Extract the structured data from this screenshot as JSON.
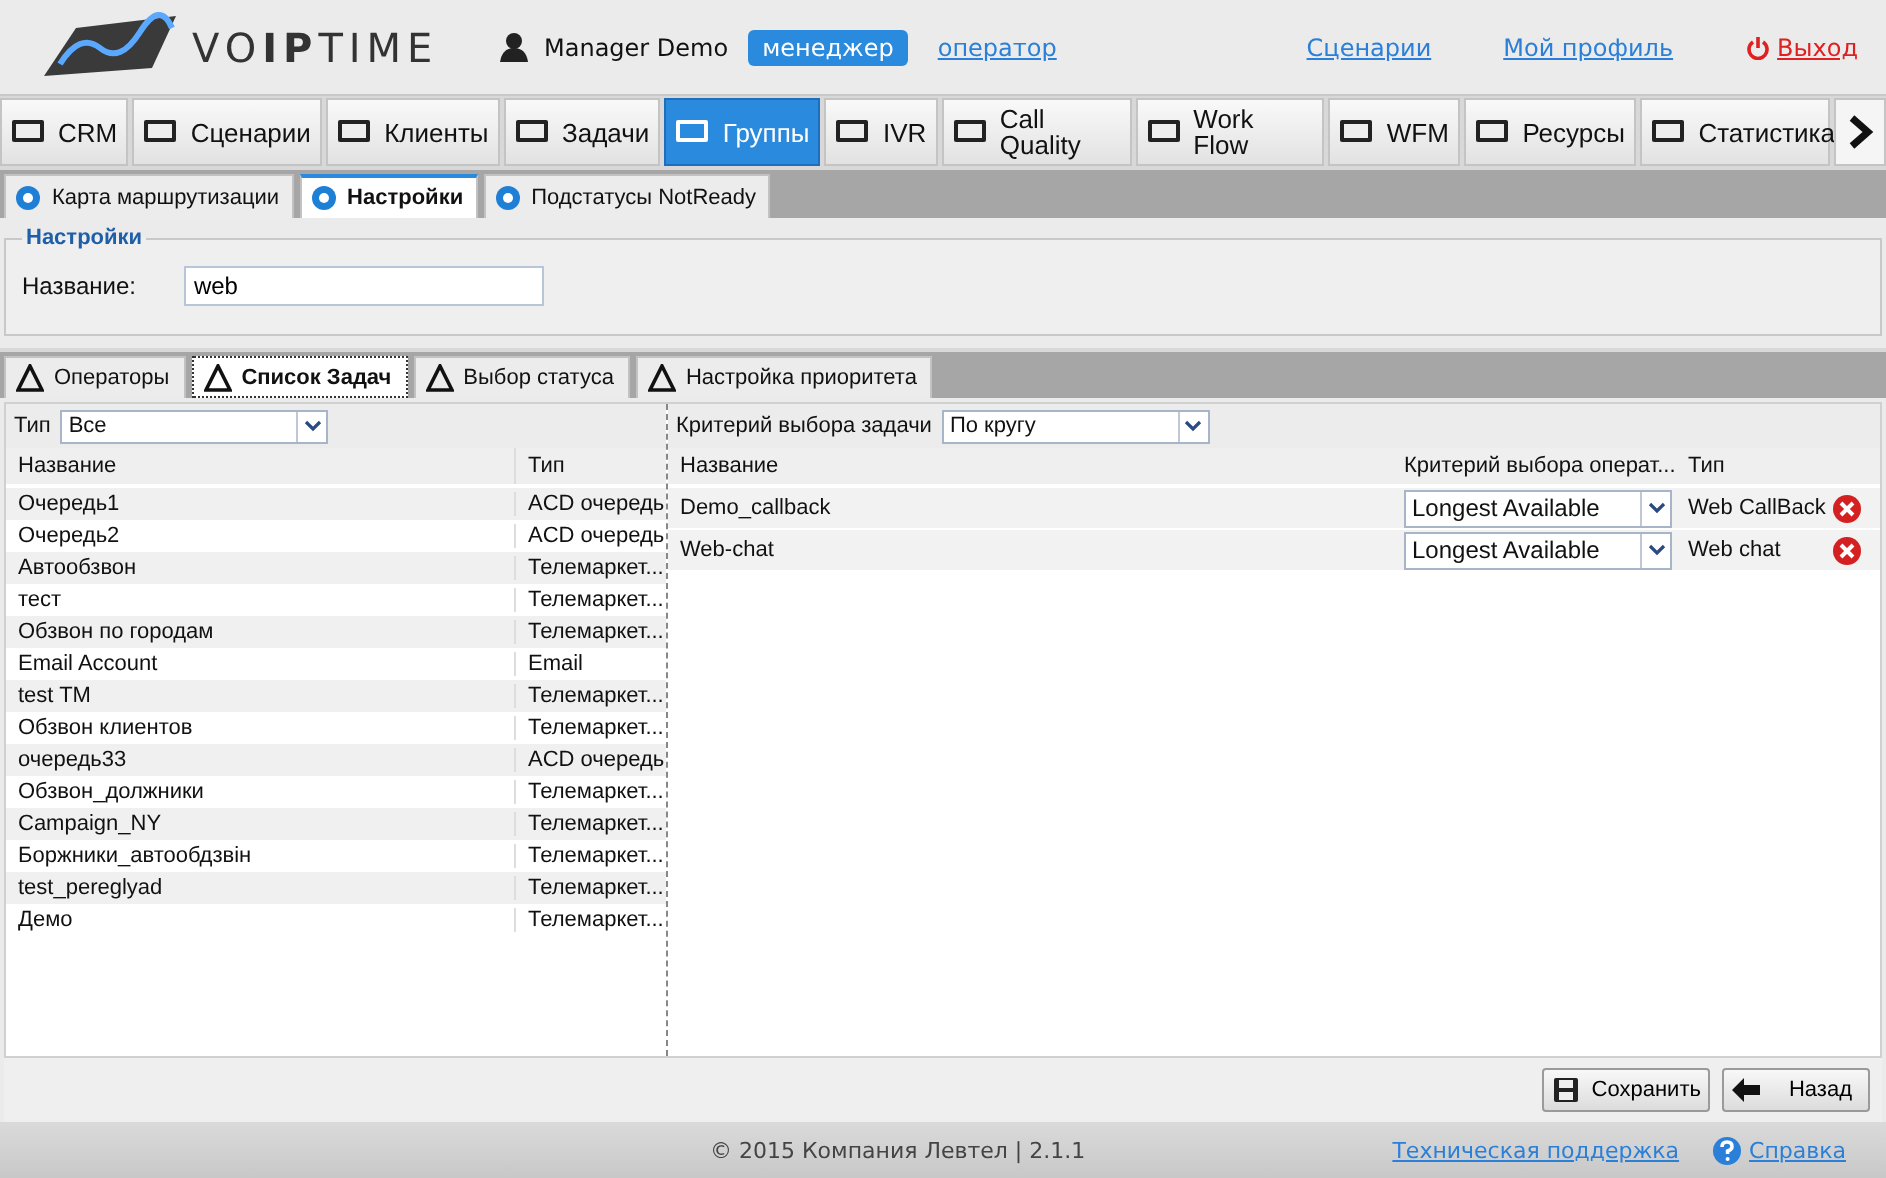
{
  "header": {
    "logo": "VO**IP**TIME",
    "user": "Manager Demo",
    "roles": [
      {
        "label": "менеджер",
        "selected": true
      },
      {
        "label": "оператор",
        "selected": false
      }
    ],
    "links": [
      "Сценарии",
      "Мой профиль"
    ],
    "logout": "Выход"
  },
  "main_tabs": [
    {
      "label": "CRM",
      "selected": false
    },
    {
      "label": "Сценарии",
      "selected": false
    },
    {
      "label": "Клиенты",
      "selected": false
    },
    {
      "label": "Задачи",
      "selected": false
    },
    {
      "label": "Группы",
      "selected": true
    },
    {
      "label": "IVR",
      "selected": false
    },
    {
      "label": "Call Quality",
      "selected": false
    },
    {
      "label": "Work Flow",
      "selected": false
    },
    {
      "label": "WFM",
      "selected": false
    },
    {
      "label": "Ресурсы",
      "selected": false
    },
    {
      "label": "Статистика",
      "selected": false
    }
  ],
  "sub_tabs": [
    {
      "label": "Карта маршрутизации",
      "selected": false
    },
    {
      "label": "Настройки",
      "selected": true
    },
    {
      "label": "Подстатусы NotReady",
      "selected": false
    }
  ],
  "settings": {
    "legend": "Настройки",
    "label": "Название:",
    "value": "web"
  },
  "inner_tabs": [
    {
      "label": "Операторы",
      "selected": false
    },
    {
      "label": "Список Задач",
      "selected": true
    },
    {
      "label": "Выбор статуса",
      "selected": false
    },
    {
      "label": "Настройка приоритета",
      "selected": false
    }
  ],
  "left": {
    "filter_label": "Тип",
    "filter_value": "Все",
    "columns": [
      "Название",
      "Тип"
    ],
    "rows": [
      {
        "name": "Очередь1",
        "type": "ACD очередь"
      },
      {
        "name": "Очередь2",
        "type": "ACD очередь"
      },
      {
        "name": "Автообзвон",
        "type": "Телемаркет..."
      },
      {
        "name": "тест",
        "type": "Телемаркет..."
      },
      {
        "name": "Обзвон по городам",
        "type": "Телемаркет..."
      },
      {
        "name": "Email Account",
        "type": "Email"
      },
      {
        "name": "test TM",
        "type": "Телемаркет..."
      },
      {
        "name": "Обзвон клиентов",
        "type": "Телемаркет..."
      },
      {
        "name": "очередь33",
        "type": "ACD очередь"
      },
      {
        "name": "Обзвон_должники",
        "type": "Телемаркет..."
      },
      {
        "name": "Campaign_NY",
        "type": "Телемаркет..."
      },
      {
        "name": "Боржники_автообдзвін",
        "type": "Телемаркет..."
      },
      {
        "name": "test_pereglyad",
        "type": "Телемаркет..."
      },
      {
        "name": "Демо",
        "type": "Телемаркет..."
      }
    ]
  },
  "right": {
    "filter_label": "Критерий выбора задачи",
    "filter_value": "По кругу",
    "columns": [
      "Название",
      "Критерий выбора операт...",
      "Тип"
    ],
    "rows": [
      {
        "name": "Demo_callback",
        "criterion": "Longest Available",
        "type": "Web CallBack"
      },
      {
        "name": "Web-chat",
        "criterion": "Longest Available",
        "type": "Web chat"
      }
    ]
  },
  "buttons": [
    "Сохранить",
    "Назад"
  ],
  "footer": {
    "copyright": "© 2015 Компания Левтел | 2.1.1",
    "links": [
      "Техническая поддержка",
      "Справка"
    ]
  }
}
